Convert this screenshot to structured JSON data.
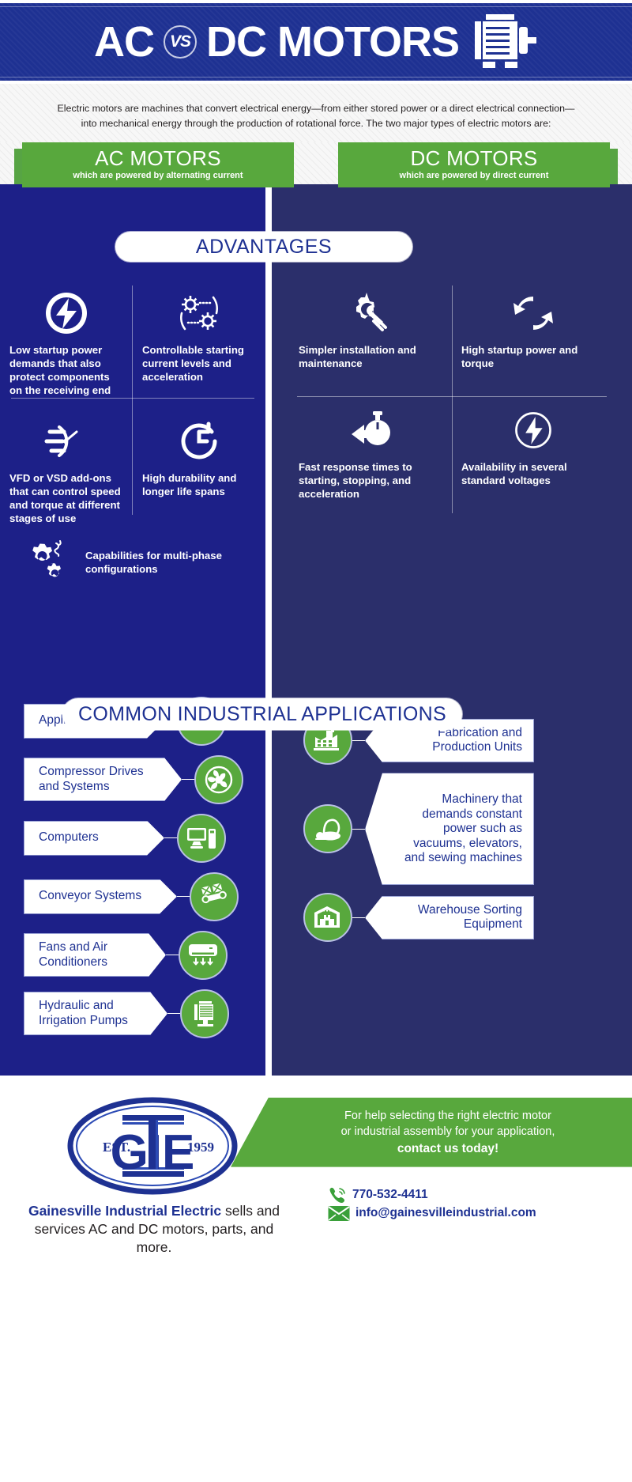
{
  "header": {
    "title_left": "AC",
    "vs": "VS",
    "title_right": "DC MOTORS",
    "motor_icon": "electric-motor-icon",
    "bg_color": "#1e3192"
  },
  "intro": {
    "paragraph": "Electric motors are machines that convert electrical energy—from either stored power or a direct electrical connection—into mechanical energy through the production of rotational force. The two major types of electric motors are:"
  },
  "categories": {
    "ac": {
      "title": "AC MOTORS",
      "subtitle": "which are powered by alternating current"
    },
    "dc": {
      "title": "DC MOTORS",
      "subtitle": "which are powered by direct current"
    },
    "green": "#58a83d"
  },
  "advantages": {
    "pill_label": "ADVANTAGES",
    "ac": [
      {
        "icon": "lightning-bolt-circle-icon",
        "text": "Low startup power demands that also protect components on the receiving end"
      },
      {
        "icon": "gears-dashed-circle-icon",
        "text": "Controllable starting current levels and acceleration"
      },
      {
        "icon": "speed-gauge-icon",
        "text": "VFD or VSD add-ons that can control speed and torque at different stages of use"
      },
      {
        "icon": "clock-refresh-icon",
        "text": "High durability and longer life spans"
      }
    ],
    "ac_extra": {
      "icon": "double-gears-icon",
      "text": "Capabilities for multi-phase configurations"
    },
    "dc": [
      {
        "icon": "gear-wrench-icon",
        "text": "Simpler installation and maintenance"
      },
      {
        "icon": "rotating-arrows-icon",
        "text": "High startup power and torque"
      },
      {
        "icon": "stopwatch-arrow-icon",
        "text": "Fast response times to starting, stopping, and acceleration"
      },
      {
        "icon": "lightning-bolt-circle-icon",
        "text": "Availability in several standard voltages"
      }
    ]
  },
  "applications": {
    "pill_label": "COMMON INDUSTRIAL APPLICATIONS",
    "ac": [
      {
        "label": "Appliances",
        "icon": "appliance-icon"
      },
      {
        "label": "Compressor Drives and Systems",
        "icon": "fan-compressor-icon"
      },
      {
        "label": "Computers",
        "icon": "computer-icon"
      },
      {
        "label": "Conveyor Systems",
        "icon": "conveyor-belt-icon"
      },
      {
        "label": "Fans and Air Conditioners",
        "icon": "air-conditioner-icon"
      },
      {
        "label": "Hydraulic and Irrigation Pumps",
        "icon": "pump-motor-icon"
      }
    ],
    "dc": [
      {
        "label": "Fabrication and Production Units",
        "icon": "factory-icon"
      },
      {
        "label": "Machinery that demands constant power such as vacuums, elevators, and sewing machines",
        "icon": "vacuum-cleaner-icon"
      },
      {
        "label": "Warehouse Sorting Equipment",
        "icon": "warehouse-icon"
      }
    ]
  },
  "footer": {
    "logo": {
      "monogram": "GIE",
      "est_label": "EST.",
      "year": "1959"
    },
    "company_bold": "Gainesville Industrial Electric",
    "company_rest": " sells and services AC and DC motors, parts, and more.",
    "banner_line1": "For help selecting the right electric motor",
    "banner_line2": "or industrial assembly for your application,",
    "banner_cta": "contact us today!",
    "phone": "770-532-4411",
    "email": "info@gainesvilleindustrial.com",
    "phone_icon": "phone-icon",
    "email_icon": "envelope-icon"
  },
  "colors": {
    "brand_blue": "#1e3192",
    "panel_ac": "#1d2088",
    "panel_dc": "#2b2f6b",
    "green": "#58a83d",
    "white": "#ffffff"
  }
}
